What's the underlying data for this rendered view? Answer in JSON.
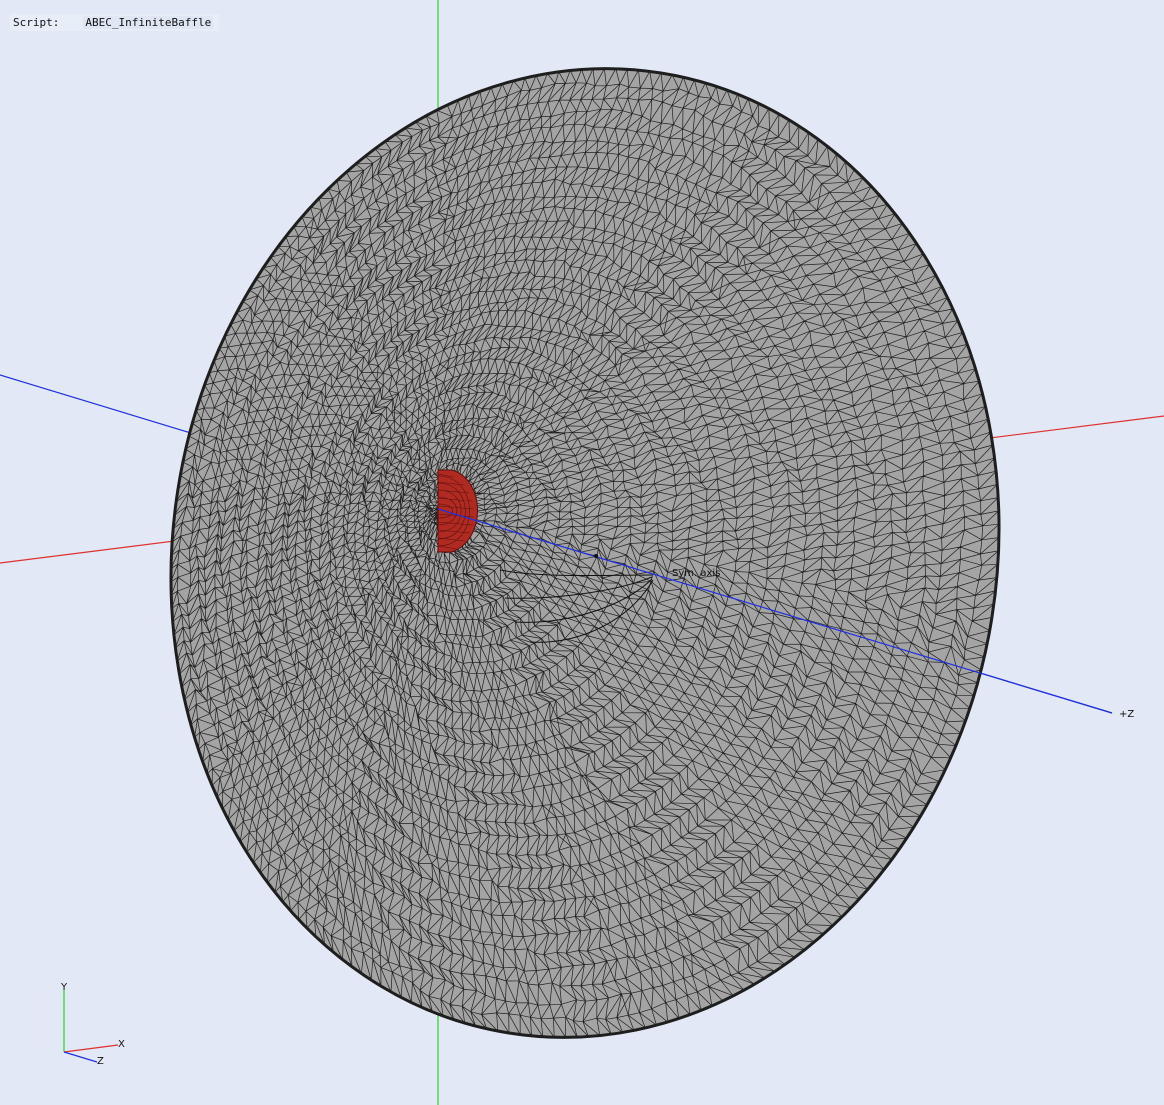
{
  "script": {
    "label": "Script:",
    "name": "ABEC_InfiniteBaffle"
  },
  "axes": {
    "z_plus": "+Z",
    "x": "X",
    "y": "Y",
    "z": "Z"
  },
  "annotation": {
    "text": "Sym. axis"
  },
  "colors": {
    "background": "#e2e8f5",
    "mesh_fill": "#a4a4a4",
    "mesh_edge": "#1e1e1e",
    "driver_fill": "#b02a22",
    "axis_x": "#e03030",
    "axis_y": "#30d030",
    "axis_z": "#2030e0"
  }
}
